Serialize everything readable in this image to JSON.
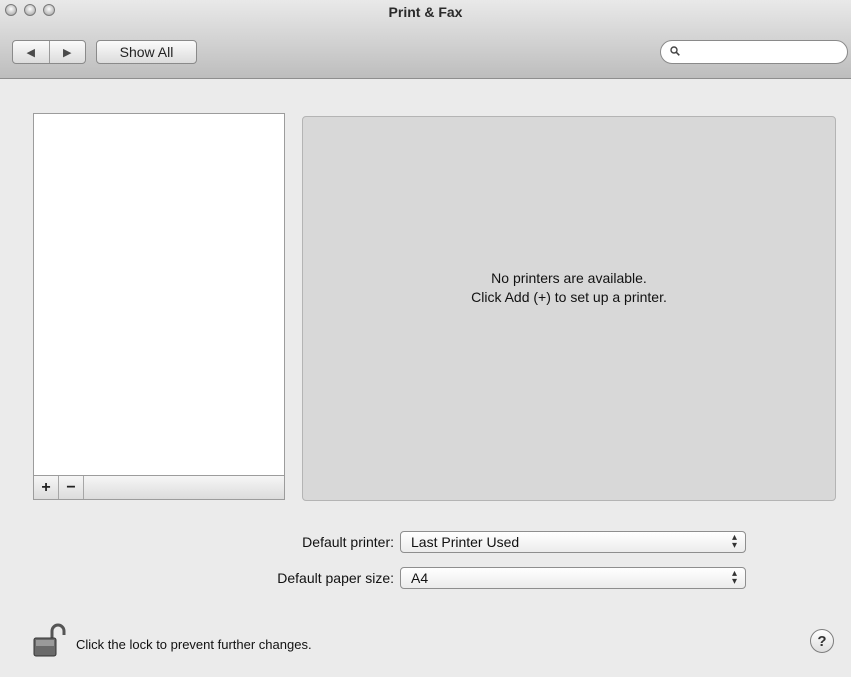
{
  "window": {
    "title": "Print & Fax"
  },
  "toolbar": {
    "back_glyph": "◀",
    "forward_glyph": "▶",
    "show_all_label": "Show All",
    "search": {
      "value": "",
      "placeholder": ""
    }
  },
  "printers": {
    "items": [],
    "empty_line1": "No printers are available.",
    "empty_line2": "Click Add (+) to set up a printer.",
    "add_label": "+",
    "remove_label": "−"
  },
  "defaults": {
    "printer_label": "Default printer:",
    "printer_value": "Last Printer Used",
    "paper_label": "Default paper size:",
    "paper_value": "A4"
  },
  "footer": {
    "lock_text": "Click the lock to prevent further changes.",
    "help_label": "?"
  },
  "icons": {
    "lock": "lock-open-icon",
    "search": "search-icon",
    "help": "help-icon"
  }
}
